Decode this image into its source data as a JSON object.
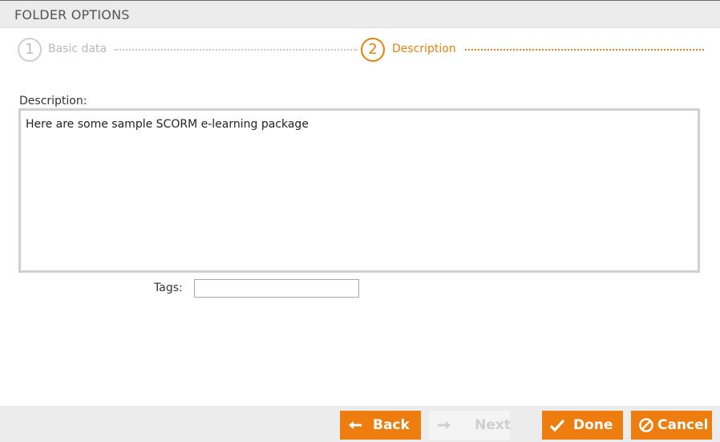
{
  "dialog": {
    "title": "FOLDER OPTIONS"
  },
  "wizard": {
    "steps": [
      {
        "number": "1",
        "label": "Basic data",
        "state": "inactive"
      },
      {
        "number": "2",
        "label": "Description",
        "state": "active"
      }
    ],
    "active_color": "#e8800c",
    "inactive_color": "#c8c8c8"
  },
  "form": {
    "description_label": "Description:",
    "description_value": "Here are some sample SCORM e-learning package",
    "tags_label": "Tags:",
    "tags_value": ""
  },
  "footer": {
    "back_label": "Back",
    "back_icon": "arrow-left-icon",
    "next_label": "Next",
    "next_icon": "arrow-right-icon",
    "done_label": "Done",
    "done_icon": "checkmark-icon",
    "cancel_label": "Cancel",
    "cancel_icon": "cancel-circle-icon",
    "accent_color": "#ee7d0f"
  }
}
